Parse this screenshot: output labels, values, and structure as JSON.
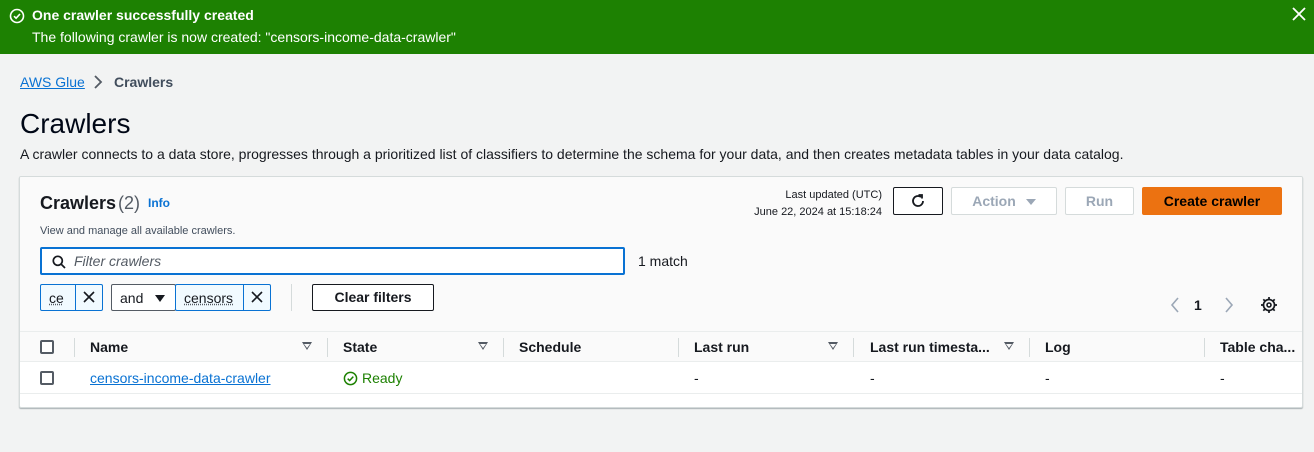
{
  "flash": {
    "title": "One crawler successfully created",
    "message": "The following crawler is now created: \"censors-income-data-crawler\"",
    "color": "#1d8102"
  },
  "breadcrumb": {
    "parent": "AWS Glue",
    "current": "Crawlers"
  },
  "page": {
    "title": "Crawlers",
    "description": "A crawler connects to a data store, progresses through a prioritized list of classifiers to determine the schema for your data, and then creates metadata tables in your data catalog."
  },
  "panel": {
    "title": "Crawlers",
    "count": "(2)",
    "info": "Info",
    "description": "View and manage all available crawlers.",
    "last_updated_label": "Last updated (UTC)",
    "last_updated_time": "June 22, 2024 at 15:18:24",
    "buttons": {
      "action": "Action",
      "run": "Run",
      "create": "Create crawler",
      "clear_filters": "Clear filters"
    },
    "filter": {
      "placeholder": "Filter crawlers",
      "value": "",
      "match": "1 match"
    },
    "tokens": {
      "first": "ce",
      "operator": "and",
      "second": "censors"
    },
    "pagination": {
      "current_page": "1"
    },
    "accent_color": "#ec7211"
  },
  "table": {
    "columns": [
      "Name",
      "State",
      "Schedule",
      "Last run",
      "Last run timesta...",
      "Log",
      "Table cha..."
    ],
    "rows": [
      {
        "name": "censors-income-data-crawler",
        "state": "Ready",
        "schedule": "",
        "last_run": "-",
        "last_run_timestamp": "-",
        "log": "-",
        "table_changes": "-"
      }
    ]
  }
}
